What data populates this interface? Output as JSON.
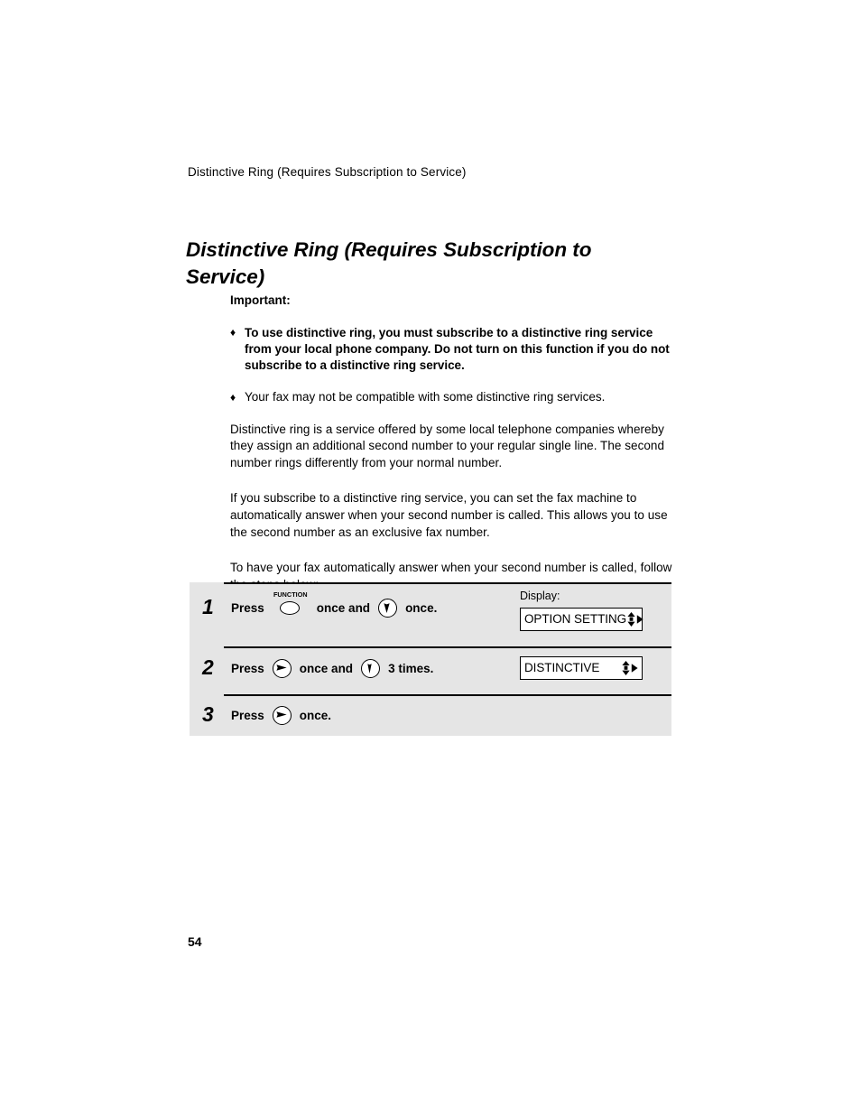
{
  "document": {
    "running_header": "Distinctive Ring (Requires Subscription to Service)",
    "title": "Distinctive Ring (Requires Subscription to Service)",
    "page_number": "54"
  },
  "important": {
    "label": "Important:",
    "bullet_glyph": "♦",
    "items": [
      {
        "text": "To use distinctive ring, you must subscribe to a distinctive ring service from your local phone company. Do not turn on this function if you do not subscribe to a distinctive ring service.",
        "bold": true
      },
      {
        "text": "Your fax may not be compatible with some distinctive ring services.",
        "bold": false
      }
    ]
  },
  "paragraphs": [
    "Distinctive ring is a service offered by some local telephone companies whereby they assign an additional second number to your regular single line. The second number rings differently from your normal number.",
    "If you subscribe to a distinctive ring service, you can set the fax machine to automatically answer when your second number is called. This allows you to use the second number as an exclusive fax number.",
    "To have your fax automatically answer when your second number is called, follow the steps below:"
  ],
  "steps_panel": {
    "display_label": "Display:",
    "background_color": "#e5e5e5",
    "steps": [
      {
        "number": "1",
        "press_label": "Press",
        "key1_name": "function-key",
        "key1_label": "FUNCTION",
        "mid_text": "once and",
        "key2_name": "down-arrow-key",
        "end_text": "once.",
        "display": {
          "text": "OPTION SETTING",
          "arrows": "up-down-right"
        }
      },
      {
        "number": "2",
        "press_label": "Press",
        "key1_name": "start-right-arrow-key",
        "mid_text": "once and",
        "key2_name": "down-arrow-key",
        "end_text": "3 times.",
        "display": {
          "text": "DISTINCTIVE",
          "arrows": "up-down-right"
        }
      },
      {
        "number": "3",
        "press_label": "Press",
        "key1_name": "start-right-arrow-key",
        "end_text": "once.",
        "display": null
      }
    ]
  }
}
